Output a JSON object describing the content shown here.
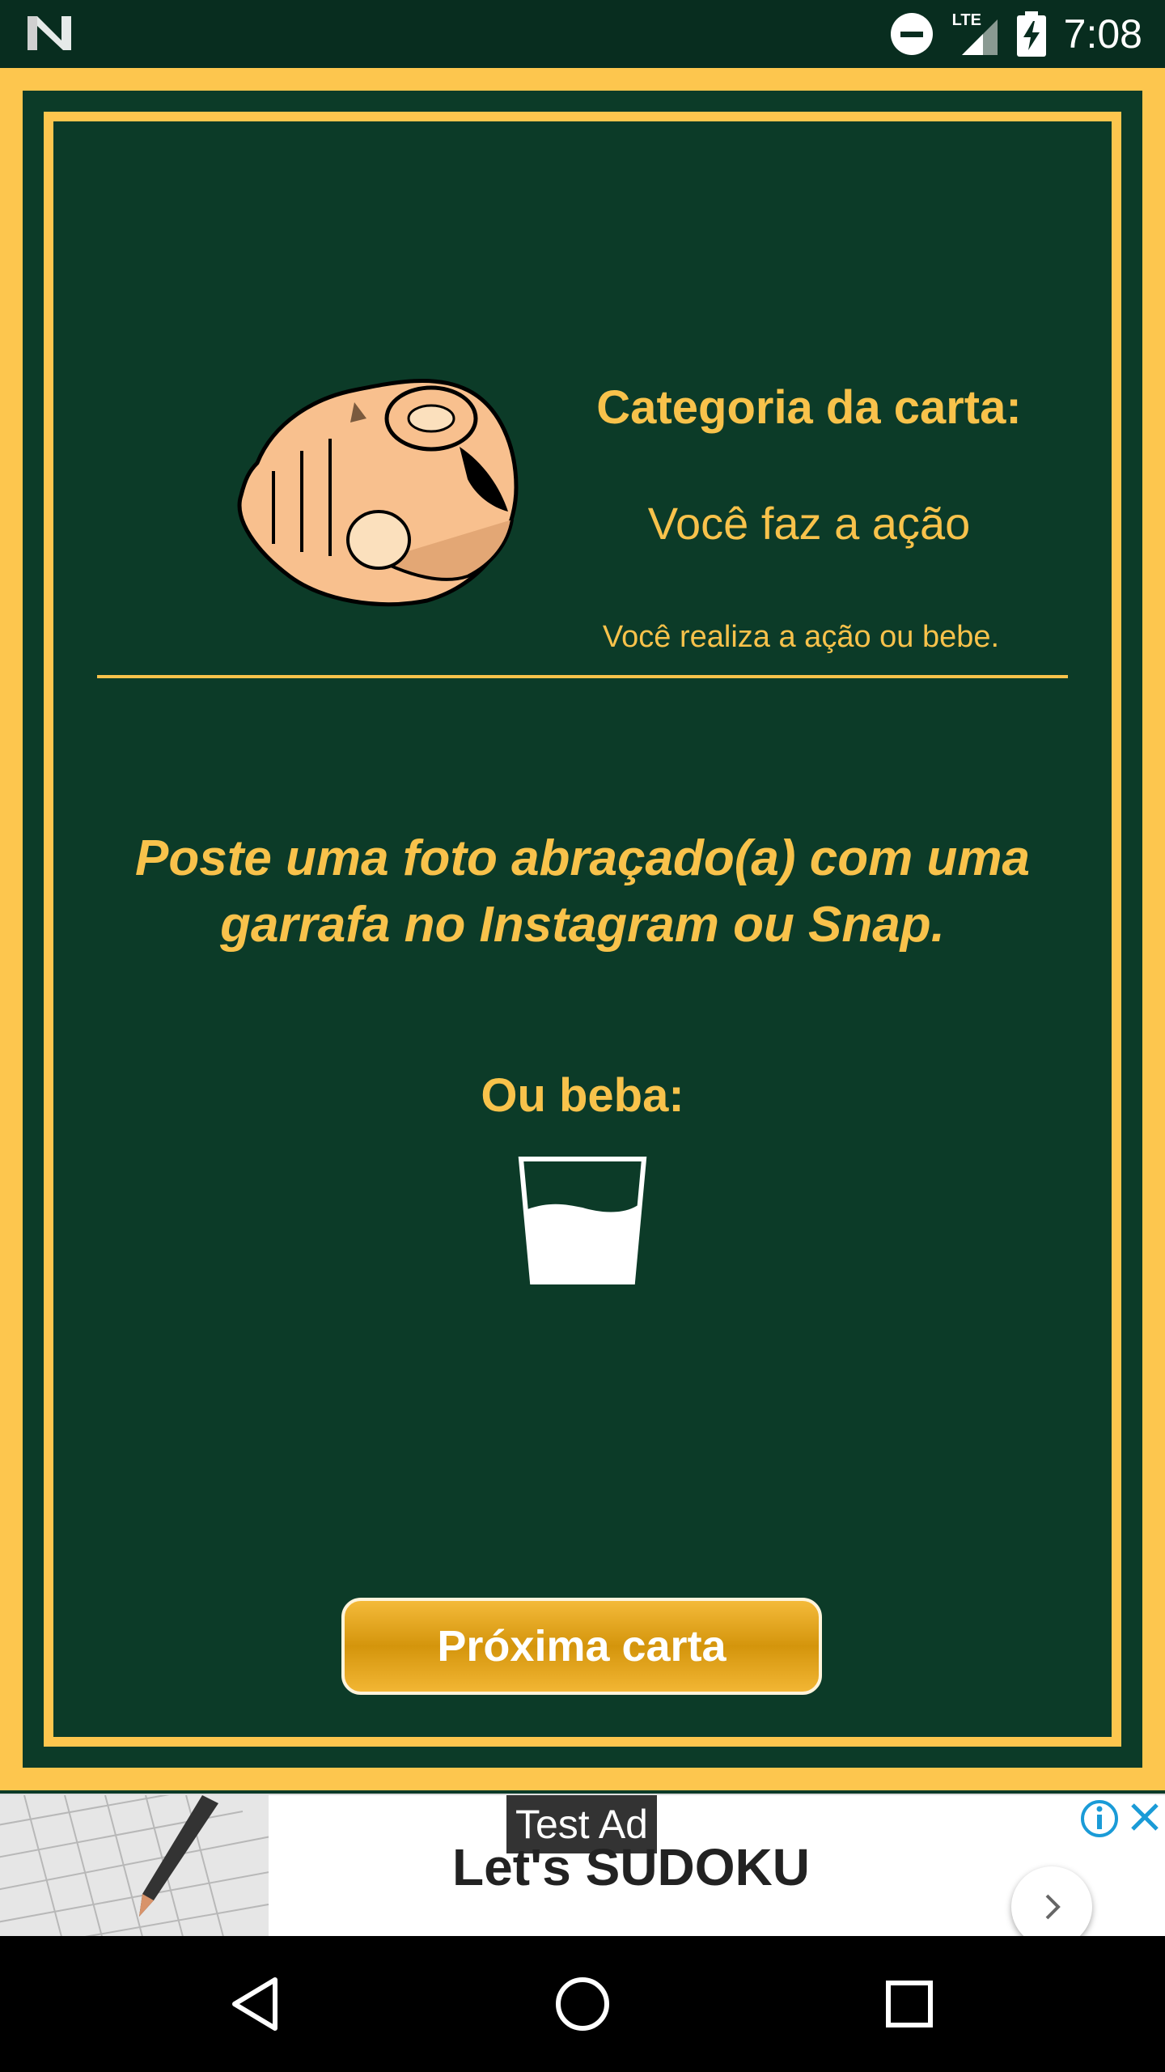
{
  "status_bar": {
    "time": "7:08",
    "network_label": "LTE",
    "icons": [
      "notification-n-icon",
      "do-not-disturb-icon",
      "signal-icon",
      "battery-charging-icon"
    ]
  },
  "card": {
    "category_title": "Categoria da carta:",
    "category_name": "Você faz a ação",
    "category_description": "Você realiza a ação ou bebe.",
    "challenge_text": "Poste uma foto abraçado(a) com uma garrafa no Instagram ou Snap.",
    "or_drink_label": "Ou beba:",
    "next_button_label": "Próxima carta",
    "icons": [
      "pointing-hand-icon",
      "glass-icon"
    ]
  },
  "ad": {
    "label": "Test Ad",
    "title": "Let's SUDOKU",
    "icons": [
      "info-icon",
      "close-icon",
      "chevron-right-icon"
    ]
  },
  "nav_bar": {
    "icons": [
      "back-icon",
      "home-icon",
      "recents-icon"
    ]
  },
  "colors": {
    "card_background": "#0c3b28",
    "accent": "#fdc64e",
    "text": "#f8c24b",
    "status_bar": "#082d1f",
    "button": "#d4950c"
  }
}
